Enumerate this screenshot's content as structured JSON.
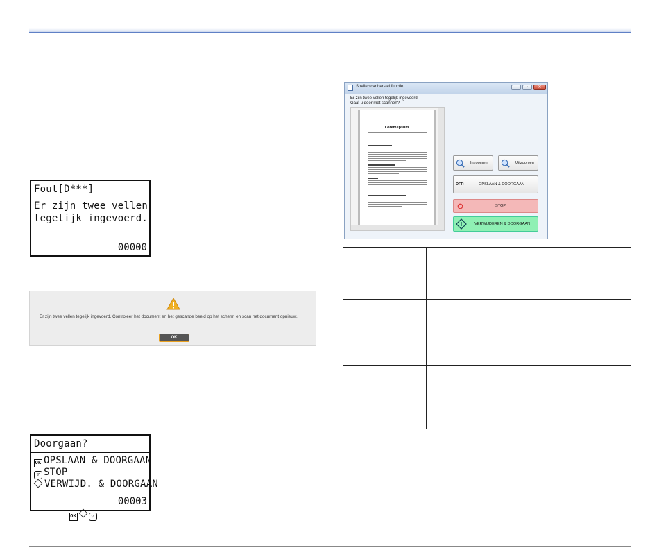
{
  "lcd_error": {
    "title": "Fout[D***]",
    "line1": "Er zijn twee vellen",
    "line2": "tegelijk ingevoerd.",
    "counter": "00000"
  },
  "warning_dialog": {
    "icon": "warning-triangle-icon",
    "message": "Er zijn twee vellen tegelijk ingevoerd. Controleer het document en het gescande beeld op het scherm en scan het document opnieuw.",
    "ok_label": "OK",
    "colors": {
      "icon": "#f0b020",
      "ok_border": "#e8a020"
    }
  },
  "lcd_continue": {
    "title": "Doorgaan?",
    "item1": "OPSLAAN & DOORGAAN",
    "item2": "STOP",
    "item3": "VERWIJD. & DOORGAAN",
    "counter": "00003"
  },
  "scan_window": {
    "title": "Snelle scanherstel functie",
    "message_line1": "Er zijn twee vellen tegelijk ingevoerd.",
    "message_line2": "Gaat u door met scannen?",
    "preview": {
      "page_title": "Lorem ipsum"
    },
    "buttons": {
      "zoom_in": "Inzoomen",
      "zoom_out": "Uitzoomen",
      "dfr_tag": "DFR",
      "save_continue": "OPSLAAN & DOORGAAN",
      "stop": "STOP",
      "delete_continue": "VERWIJDEREN & DOORGAAN"
    },
    "colors": {
      "stop_bg": "#f4b8b8",
      "delete_bg": "#8ff0b4"
    }
  }
}
